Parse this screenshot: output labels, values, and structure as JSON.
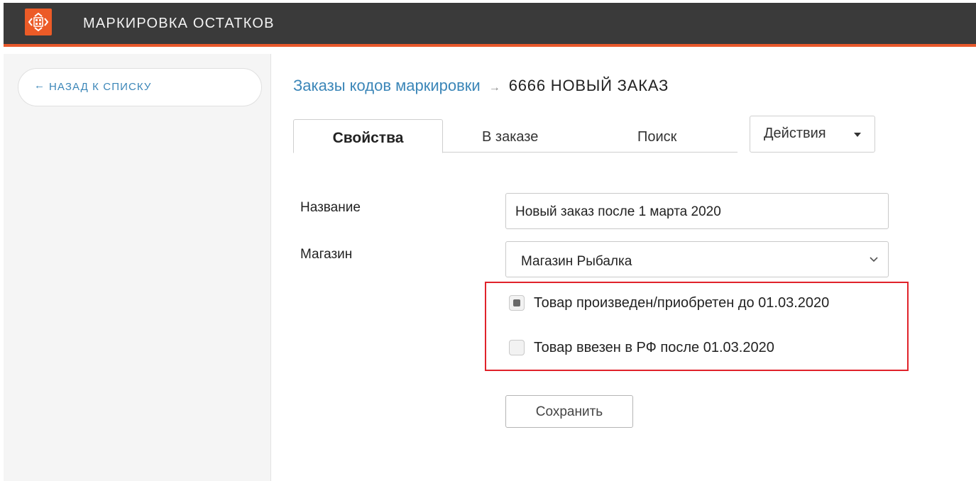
{
  "app": {
    "title": "МАРКИРОВКА ОСТАТКОВ",
    "accent_color": "#ec5b27",
    "header_bg": "#3a3a3a",
    "logo_icon": "barcode-scan-icon"
  },
  "sidebar": {
    "back_arrow": "←",
    "back_label": "НАЗАД К СПИСКУ"
  },
  "breadcrumb": {
    "parent": "Заказы кодов маркировки",
    "separator": "→",
    "current": "6666 НОВЫЙ ЗАКАЗ"
  },
  "tabs": {
    "active": "Свойства",
    "order": "В заказе",
    "search": "Поиск"
  },
  "actions": {
    "label": "Действия"
  },
  "form": {
    "name_label": "Название",
    "name_value": "Новый заказ после 1 марта 2020",
    "shop_label": "Магазин",
    "shop_value": "Магазин Рыбалка",
    "checkbox1_label": "Товар произведен/приобретен до 01.03.2020",
    "checkbox1_checked": true,
    "checkbox2_label": "Товар ввезен в РФ после 01.03.2020",
    "checkbox2_checked": false,
    "highlight_color": "#e0222a",
    "save_label": "Сохранить"
  }
}
